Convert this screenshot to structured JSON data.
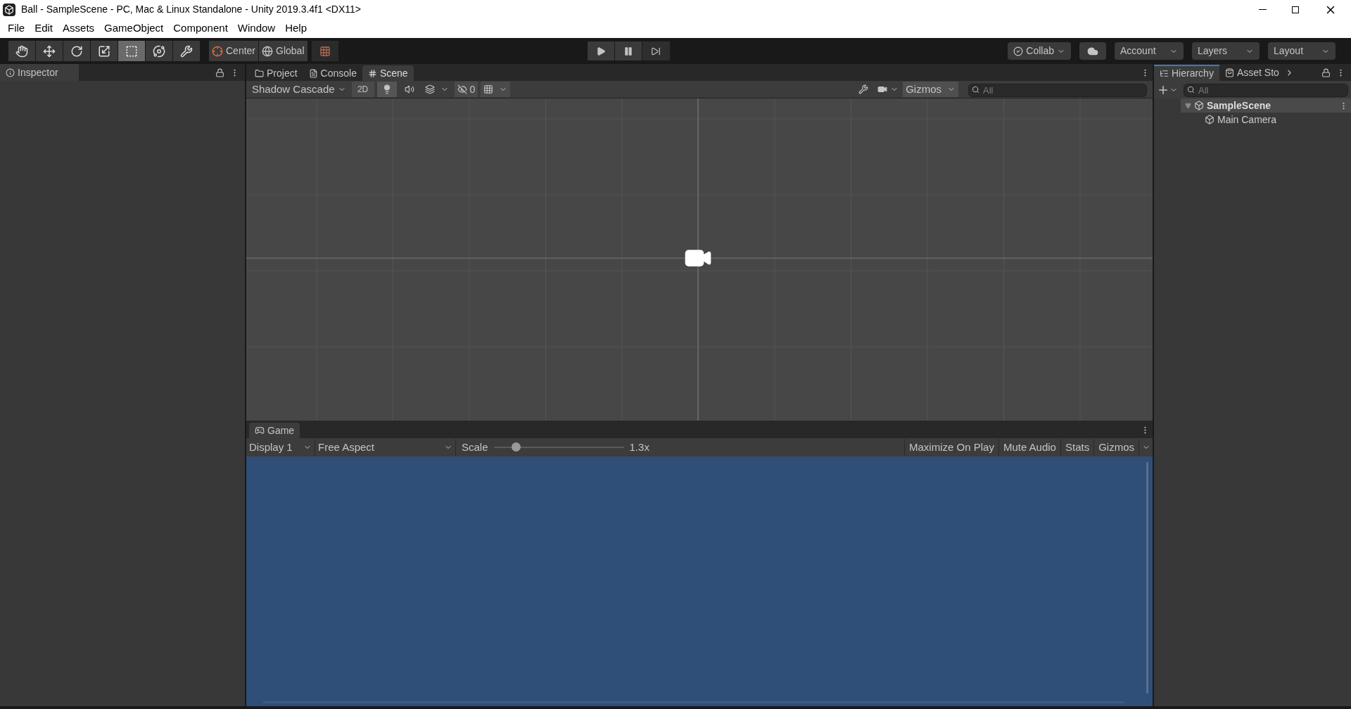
{
  "window": {
    "title": "Ball - SampleScene - PC, Mac & Linux Standalone - Unity 2019.3.4f1 <DX11>"
  },
  "menu": [
    "File",
    "Edit",
    "Assets",
    "GameObject",
    "Component",
    "Window",
    "Help"
  ],
  "tools": [
    {
      "kind": "hand",
      "selected": false
    },
    {
      "kind": "move",
      "selected": false
    },
    {
      "kind": "rotate",
      "selected": false
    },
    {
      "kind": "scale",
      "selected": false
    },
    {
      "kind": "rect",
      "selected": true
    },
    {
      "kind": "transform",
      "selected": false
    },
    {
      "kind": "custom",
      "selected": false
    }
  ],
  "pivot": {
    "mode": "Center",
    "space": "Global"
  },
  "toolbar_right": {
    "collab": "Collab",
    "account": "Account",
    "layers": "Layers",
    "layout": "Layout"
  },
  "inspector": {
    "tab": "Inspector"
  },
  "center_tabs": [
    {
      "label": "Project",
      "kind": "project",
      "selected": false
    },
    {
      "label": "Console",
      "kind": "console",
      "selected": false
    },
    {
      "label": "Scene",
      "kind": "scene",
      "selected": true
    }
  ],
  "scene_toolbar": {
    "lighting_on": true,
    "audio_on": false,
    "effects_on": false,
    "grid_on": true,
    "draw_mode": "Shadow Cascade",
    "mode_2d": "2D",
    "hidden_count": "0",
    "gizmos": "Gizmos",
    "search": {
      "placeholder": "All"
    }
  },
  "game": {
    "tab": "Game",
    "display": "Display 1",
    "aspect": "Free Aspect",
    "scale_label": "Scale",
    "scale": {
      "level": 0.17
    },
    "scale_value": "1.3x",
    "buttons": [
      "Maximize On Play",
      "Mute Audio",
      "Stats",
      "Gizmos"
    ]
  },
  "hierarchy": {
    "tabs": [
      {
        "label": "Hierarchy",
        "kind": "hierarchy",
        "selected": true
      },
      {
        "label": "Asset Sto",
        "kind": "store",
        "selected": false
      }
    ],
    "search": {
      "placeholder": "All"
    },
    "tree": [
      {
        "label": "SampleScene",
        "kind": "scene",
        "expanded": true,
        "children": [
          {
            "label": "Main Camera",
            "kind": "object"
          }
        ]
      }
    ]
  }
}
